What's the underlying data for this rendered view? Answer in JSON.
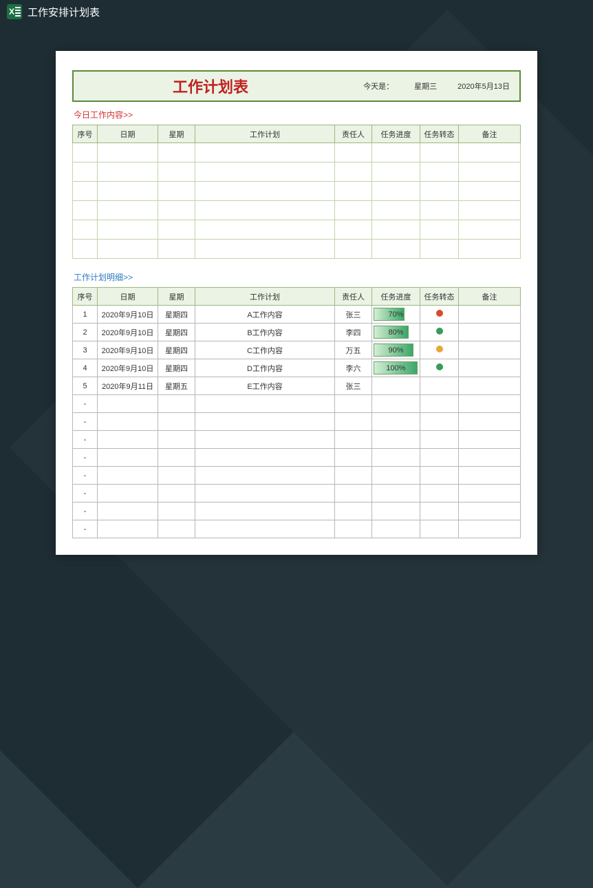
{
  "app": {
    "title": "工作安排计划表"
  },
  "header": {
    "title": "工作计划表",
    "today_label": "今天是：",
    "weekday": "星期三",
    "date": "2020年5月13日"
  },
  "section_today": {
    "label": "今日工作内容>>"
  },
  "section_detail": {
    "label": "工作计划明细>>"
  },
  "columns": {
    "seq": "序号",
    "date": "日期",
    "weekday": "星期",
    "plan": "工作计划",
    "owner": "责任人",
    "progress": "任务进度",
    "status": "任务转态",
    "note": "备注"
  },
  "today_rows": [
    {},
    {},
    {},
    {},
    {},
    {}
  ],
  "detail_rows": [
    {
      "seq": "1",
      "date": "2020年9月10日",
      "weekday": "星期四",
      "plan": "A工作内容",
      "owner": "张三",
      "progress": "70%",
      "progress_pct": 70,
      "status_color": "red"
    },
    {
      "seq": "2",
      "date": "2020年9月10日",
      "weekday": "星期四",
      "plan": "B工作内容",
      "owner": "李四",
      "progress": "80%",
      "progress_pct": 80,
      "status_color": "green"
    },
    {
      "seq": "3",
      "date": "2020年9月10日",
      "weekday": "星期四",
      "plan": "C工作内容",
      "owner": "万五",
      "progress": "90%",
      "progress_pct": 90,
      "status_color": "yellow"
    },
    {
      "seq": "4",
      "date": "2020年9月10日",
      "weekday": "星期四",
      "plan": "D工作内容",
      "owner": "李六",
      "progress": "100%",
      "progress_pct": 100,
      "status_color": "green"
    },
    {
      "seq": "5",
      "date": "2020年9月11日",
      "weekday": "星期五",
      "plan": "E工作内容",
      "owner": "张三",
      "progress": "",
      "progress_pct": null,
      "status_color": ""
    },
    {
      "seq": "-",
      "date": "",
      "weekday": "",
      "plan": "",
      "owner": "",
      "progress": "",
      "progress_pct": null,
      "status_color": ""
    },
    {
      "seq": "-",
      "date": "",
      "weekday": "",
      "plan": "",
      "owner": "",
      "progress": "",
      "progress_pct": null,
      "status_color": ""
    },
    {
      "seq": "-",
      "date": "",
      "weekday": "",
      "plan": "",
      "owner": "",
      "progress": "",
      "progress_pct": null,
      "status_color": ""
    },
    {
      "seq": "-",
      "date": "",
      "weekday": "",
      "plan": "",
      "owner": "",
      "progress": "",
      "progress_pct": null,
      "status_color": ""
    },
    {
      "seq": "-",
      "date": "",
      "weekday": "",
      "plan": "",
      "owner": "",
      "progress": "",
      "progress_pct": null,
      "status_color": ""
    },
    {
      "seq": "-",
      "date": "",
      "weekday": "",
      "plan": "",
      "owner": "",
      "progress": "",
      "progress_pct": null,
      "status_color": ""
    },
    {
      "seq": "-",
      "date": "",
      "weekday": "",
      "plan": "",
      "owner": "",
      "progress": "",
      "progress_pct": null,
      "status_color": ""
    },
    {
      "seq": "-",
      "date": "",
      "weekday": "",
      "plan": "",
      "owner": "",
      "progress": "",
      "progress_pct": null,
      "status_color": ""
    }
  ]
}
